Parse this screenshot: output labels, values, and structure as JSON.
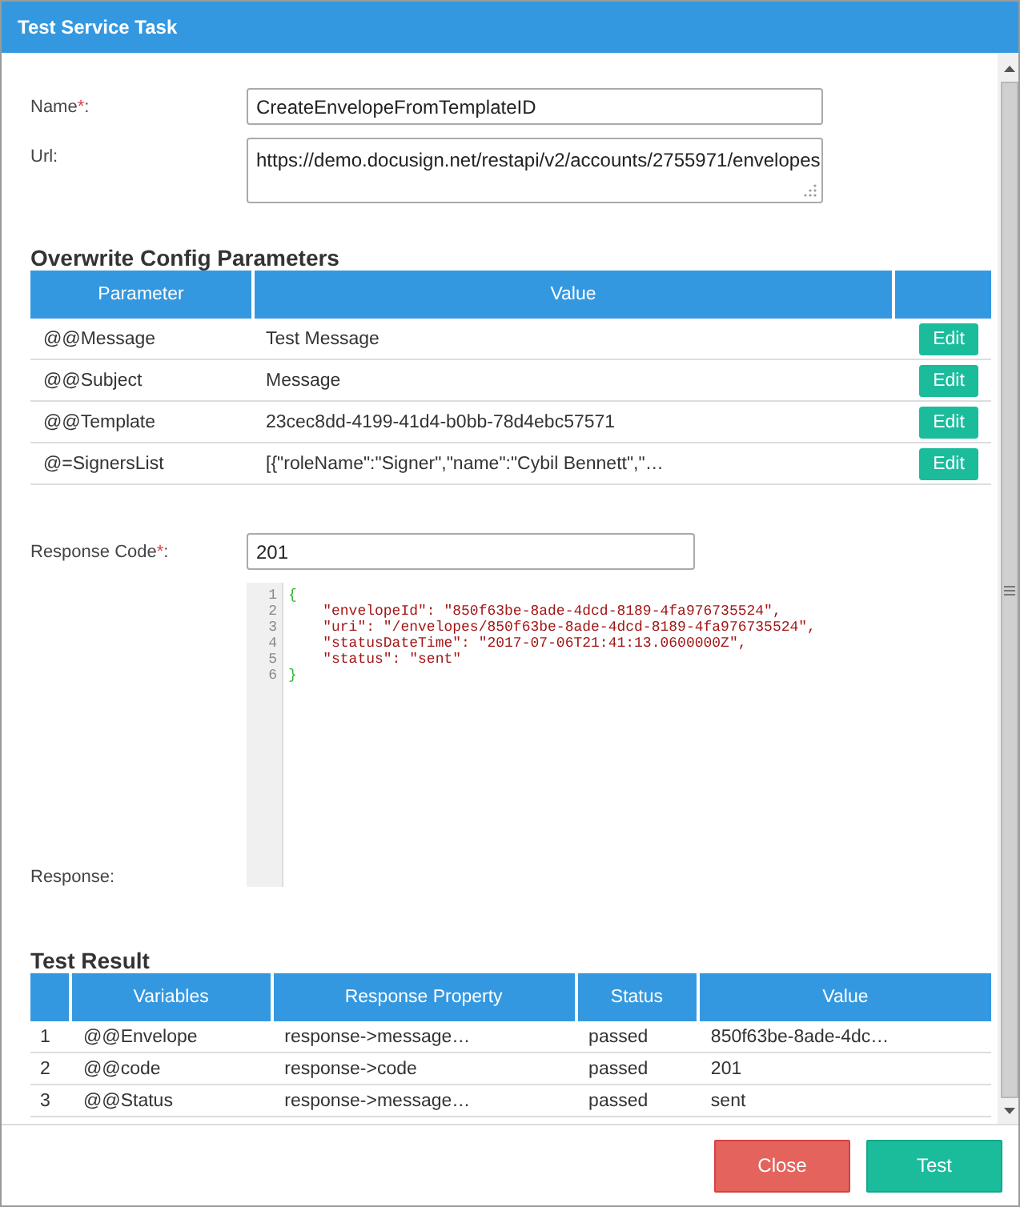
{
  "window": {
    "title": "Test Service Task"
  },
  "form": {
    "name": {
      "label": "Name",
      "asterisk": "*",
      "label_end": ":",
      "value": "CreateEnvelopeFromTemplateID"
    },
    "url": {
      "label": "Url:",
      "value": "https://demo.docusign.net/restapi/v2/accounts/2755971/envelopes"
    }
  },
  "config": {
    "title": "Overwrite Config Parameters",
    "columns": [
      "Parameter",
      "Value"
    ],
    "rows": [
      {
        "parameter": "@@Message",
        "value": "Test Message",
        "action": "Edit"
      },
      {
        "parameter": "@@Subject",
        "value": "Message",
        "action": "Edit"
      },
      {
        "parameter": "@@Template",
        "value": "23cec8dd-4199-41d4-b0bb-78d4ebc57571",
        "action": "Edit"
      },
      {
        "parameter": "@=SignersList",
        "value": "[{\"roleName\":\"Signer\",\"name\":\"Cybil Bennett\",\"…",
        "action": "Edit"
      }
    ]
  },
  "response_code": {
    "label": "Response Code",
    "asterisk": "*",
    "label_end": ":",
    "value": "201"
  },
  "response": {
    "label": "Response:",
    "lines": [
      {
        "number": "1",
        "kind": "brace",
        "text": "{"
      },
      {
        "number": "2",
        "kind": "pair",
        "text": "    \"envelopeId\": \"850f63be-8ade-4dcd-8189-4fa976735524\","
      },
      {
        "number": "3",
        "kind": "pair",
        "text": "    \"uri\": \"/envelopes/850f63be-8ade-4dcd-8189-4fa976735524\","
      },
      {
        "number": "4",
        "kind": "pair",
        "text": "    \"statusDateTime\": \"2017-07-06T21:41:13.0600000Z\","
      },
      {
        "number": "5",
        "kind": "pair",
        "text": "    \"status\": \"sent\""
      },
      {
        "number": "6",
        "kind": "brace",
        "text": "}"
      }
    ]
  },
  "test_result": {
    "title": "Test Result",
    "columns": [
      "Variables",
      "Response Property",
      "Status",
      "Value"
    ],
    "rows": [
      {
        "index": "1",
        "variable": "@@Envelope",
        "property": "response->message…",
        "status": "passed",
        "value": "850f63be-8ade-4dc…"
      },
      {
        "index": "2",
        "variable": "@@code",
        "property": "response->code",
        "status": "passed",
        "value": "201"
      },
      {
        "index": "3",
        "variable": "@@Status",
        "property": "response->message…",
        "status": "passed",
        "value": "sent"
      }
    ]
  },
  "buttons": [
    {
      "label": "Close",
      "kind": "danger"
    },
    {
      "label": "Test",
      "kind": "primary"
    }
  ]
}
